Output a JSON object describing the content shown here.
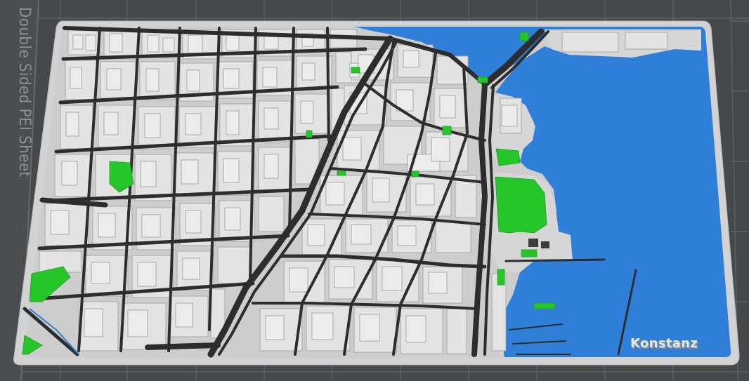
{
  "viewport": {
    "bed_label": "Double Sided PEI Sheet",
    "model_label": "Konstanz"
  },
  "colors": {
    "bed": "#46494c",
    "bed_grid": "#5a5e62",
    "plate_rim": "#d4d4d4",
    "ground": "#cfcfcf",
    "building": "#e2e2e2",
    "building_shadow": "#a9a9a9",
    "street": "#2b2d2f",
    "water": "#2f7fd8",
    "park": "#26c62a"
  }
}
